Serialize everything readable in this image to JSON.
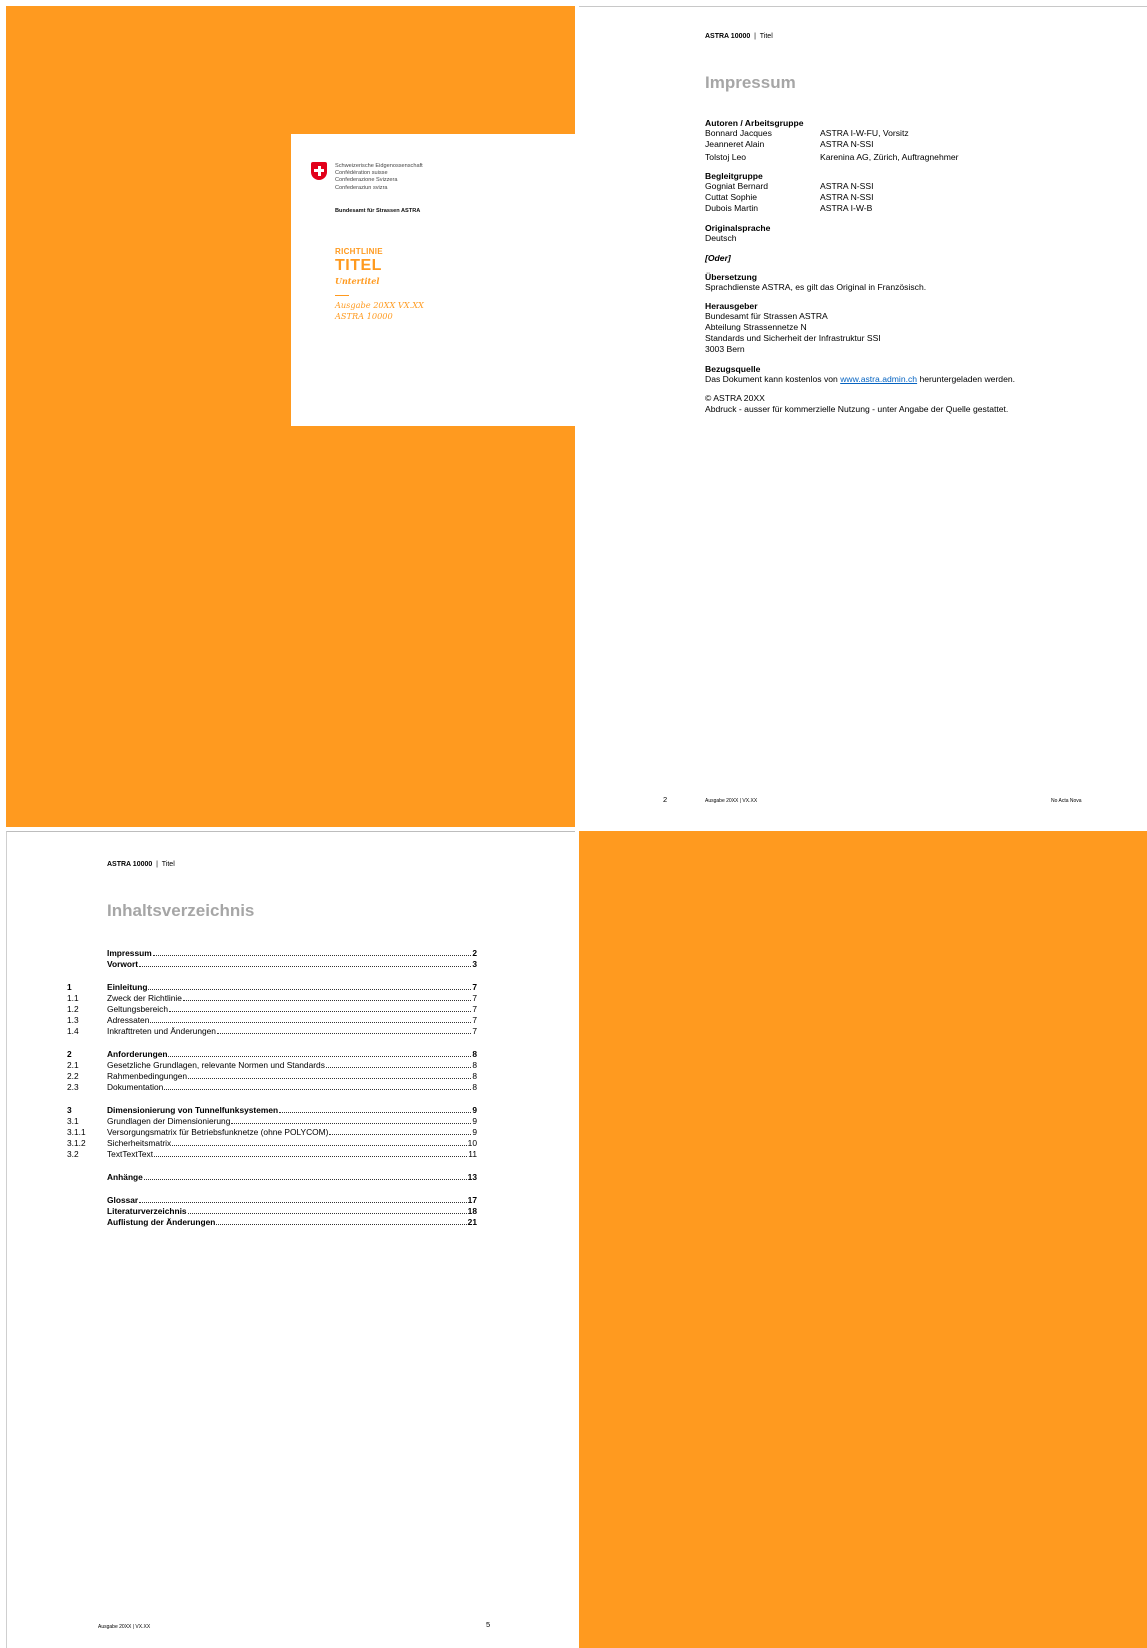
{
  "cover": {
    "confed_lines": [
      "Schweizerische Eidgenossenschaft",
      "Confédération suisse",
      "Confederazione Svizzera",
      "Confederaziun svizra"
    ],
    "office": "Bundesamt für Strassen ASTRA",
    "doc_type": "RICHTLINIE",
    "title": "TITEL",
    "subtitle": "Untertitel",
    "edition_line1": "Ausgabe 20XX VX.XX",
    "edition_line2": "ASTRA 10000",
    "colors": {
      "accent": "#FF9A1F",
      "flag": "#e2001a"
    }
  },
  "impressum": {
    "header_doc": "ASTRA 10000",
    "header_sep": "|",
    "header_title": "Titel",
    "title": "Impressum",
    "authors_label": "Autoren / Arbeitsgruppe",
    "authors": [
      {
        "name": "Bonnard Jacques",
        "org": "ASTRA I-W-FU, Vorsitz"
      },
      {
        "name": "Jeanneret Alain",
        "org": "ASTRA N-SSI"
      },
      {
        "name": "Tolstoj Leo",
        "org": "Karenina AG, Zürich, Auftragnehmer"
      }
    ],
    "group_label": "Begleitgruppe",
    "group": [
      {
        "name": "Gogniat Bernard",
        "org": "ASTRA N-SSI"
      },
      {
        "name": "Cuttat Sophie",
        "org": "ASTRA N-SSI"
      },
      {
        "name": "Dubois Martin",
        "org": "ASTRA I-W-B"
      }
    ],
    "orig_lang_label": "Originalsprache",
    "orig_lang": "Deutsch",
    "oder": "[Oder]",
    "translation_label": "Übersetzung",
    "translation": "Sprachdienste ASTRA, es gilt das Original in Französisch.",
    "publisher_label": "Herausgeber",
    "publisher_lines": [
      "Bundesamt für Strassen ASTRA",
      "Abteilung Strassennetze N",
      "Standards und Sicherheit der Infrastruktur SSI",
      "3003 Bern"
    ],
    "source_label": "Bezugsquelle",
    "source_pre": "Das Dokument kann kostenlos von ",
    "source_link": "www.astra.admin.ch",
    "source_post": " heruntergeladen werden.",
    "copyright": "© ASTRA 20XX",
    "reprint": "Abdruck - ausser für kommerzielle Nutzung - unter Angabe der Quelle gestattet.",
    "page_no": "2",
    "footer_edition": "Ausgabe 20XX  |  VX.XX",
    "footer_right": "No Acta Nova"
  },
  "toc": {
    "header_doc": "ASTRA 10000",
    "header_sep": "|",
    "header_title": "Titel",
    "title": "Inhaltsverzeichnis",
    "entries": [
      {
        "num": "",
        "text": "Impressum",
        "page": "2",
        "bold": true
      },
      {
        "num": "",
        "text": "Vorwort",
        "page": "3",
        "bold": true
      },
      {
        "gap": true
      },
      {
        "num": "1",
        "text": "Einleitung",
        "page": "7",
        "bold": true
      },
      {
        "num": "1.1",
        "text": "Zweck der Richtlinie",
        "page": "7",
        "bold": false
      },
      {
        "num": "1.2",
        "text": "Geltungsbereich",
        "page": "7",
        "bold": false
      },
      {
        "num": "1.3",
        "text": "Adressaten",
        "page": "7",
        "bold": false
      },
      {
        "num": "1.4",
        "text": "Inkrafttreten und Änderungen",
        "page": "7",
        "bold": false
      },
      {
        "gap": true
      },
      {
        "num": "2",
        "text": "Anforderungen",
        "page": "8",
        "bold": true
      },
      {
        "num": "2.1",
        "text": "Gesetzliche Grundlagen, relevante Normen und Standards",
        "page": "8",
        "bold": false
      },
      {
        "num": "2.2",
        "text": "Rahmenbedingungen",
        "page": "8",
        "bold": false
      },
      {
        "num": "2.3",
        "text": "Dokumentation",
        "page": "8",
        "bold": false
      },
      {
        "gap": true
      },
      {
        "num": "3",
        "text": "Dimensionierung von Tunnelfunksystemen",
        "page": "9",
        "bold": true
      },
      {
        "num": "3.1",
        "text": "Grundlagen der Dimensionierung",
        "page": "9",
        "bold": false
      },
      {
        "num": "3.1.1",
        "text": "Versorgungsmatrix für Betriebsfunknetze (ohne POLYCOM)",
        "page": "9",
        "bold": false
      },
      {
        "num": "3.1.2",
        "text": "Sicherheitsmatrix",
        "page": "10",
        "bold": false
      },
      {
        "num": "3.2",
        "text": "TextTextText",
        "page": "11",
        "bold": false
      },
      {
        "gap": true
      },
      {
        "num": "",
        "text": "Anhänge",
        "page": "13",
        "bold": true
      },
      {
        "gap": true
      },
      {
        "num": "",
        "text": "Glossar",
        "page": "17",
        "bold": true
      },
      {
        "num": "",
        "text": "Literaturverzeichnis",
        "page": "18",
        "bold": true
      },
      {
        "num": "",
        "text": "Auflistung der Änderungen",
        "page": "21",
        "bold": true
      }
    ],
    "footer_edition": "Ausgabe 20XX  |  VX.XX",
    "page_no": "5"
  }
}
